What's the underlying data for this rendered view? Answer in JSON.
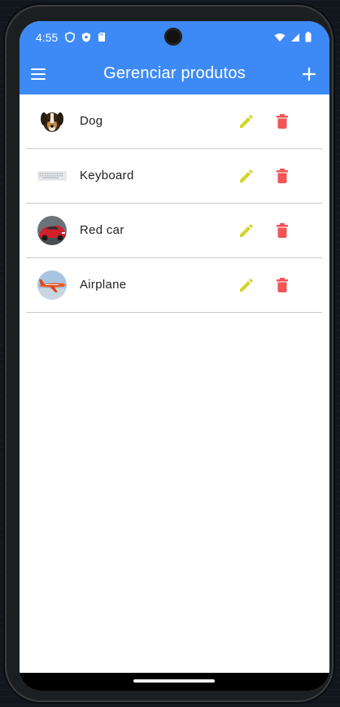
{
  "status_bar": {
    "time": "4:55"
  },
  "app_bar": {
    "title": "Gerenciar produtos"
  },
  "products": [
    {
      "name": "Dog",
      "icon": "dog-thumbnail"
    },
    {
      "name": "Keyboard",
      "icon": "keyboard-thumbnail"
    },
    {
      "name": "Red car",
      "icon": "red-car-thumbnail"
    },
    {
      "name": "Airplane",
      "icon": "airplane-thumbnail"
    }
  ],
  "colors": {
    "primary": "#3d8af7",
    "edit": "#d4d42a",
    "delete": "#f25555",
    "divider": "#c9c9c9"
  }
}
